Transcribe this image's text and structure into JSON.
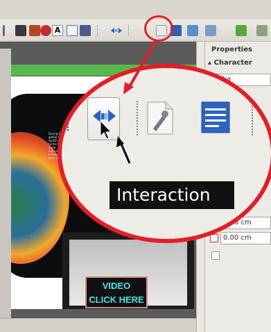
{
  "sidebar": {
    "title": "Properties",
    "section": "▴ Character",
    "font_name": "...tika",
    "spacing_above": "0.00 cm",
    "spacing_below": "0.00 cm"
  },
  "slide": {
    "video_label_line1": "VIDEO",
    "video_label_line2": "CLICK HERE",
    "body_text": "During the past century, global sea level... most of the world's warming... attributed to the United States... large-scale... Some predictions... indicate increasingly hot summers and intense downpours..."
  },
  "magnifier": {
    "tooltip": "Interaction",
    "highlighted_button": "interaction-icon"
  },
  "colors": {
    "callout_red": "#e51d24",
    "video_label_text": "#3fe8e8",
    "accent_green": "#59b84b"
  }
}
